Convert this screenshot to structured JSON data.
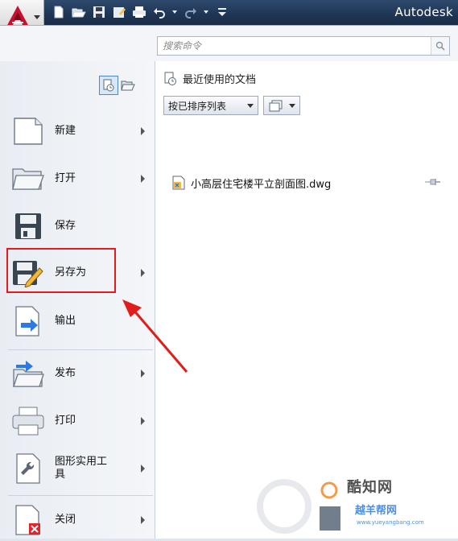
{
  "title_bar": {
    "brand": "Autodesk"
  },
  "search": {
    "placeholder": "搜索命令"
  },
  "left_menu": {
    "items": [
      {
        "label": "新建",
        "icon": "new-document-icon",
        "has_submenu": true
      },
      {
        "label": "打开",
        "icon": "open-folder-icon",
        "has_submenu": true
      },
      {
        "label": "保存",
        "icon": "save-icon",
        "has_submenu": false
      },
      {
        "label": "另存为",
        "icon": "save-as-icon",
        "has_submenu": true,
        "highlighted": true
      },
      {
        "label": "输出",
        "icon": "export-icon",
        "has_submenu": true
      },
      {
        "label": "发布",
        "icon": "publish-icon",
        "has_submenu": true
      },
      {
        "label": "打印",
        "icon": "printer-icon",
        "has_submenu": true
      },
      {
        "label": "图形实用工具",
        "label_line1": "图形实用工",
        "label_line2": "具",
        "icon": "wrench-icon",
        "has_submenu": true
      },
      {
        "label": "关闭",
        "icon": "close-document-icon",
        "has_submenu": true
      }
    ]
  },
  "recent": {
    "title": "最近使用的文档",
    "sort_label": "按已排序列表",
    "documents": [
      {
        "name": "小高层住宅楼平立剖面图.dwg"
      }
    ]
  },
  "watermark": {
    "line1": "酷知网",
    "line2": "越羊帮网",
    "line3": "www.yueyangbang.com"
  },
  "colors": {
    "highlight": "#e21b1b",
    "title_bar": "#1f3554",
    "accent": "#2d7be0"
  }
}
